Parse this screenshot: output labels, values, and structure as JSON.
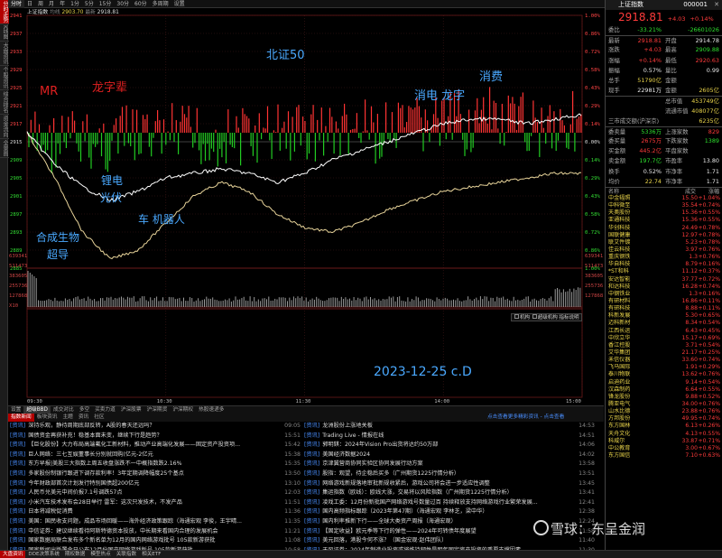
{
  "left_tabs": [
    "分时走势",
    "K线图",
    "大盘资讯",
    "个股资讯",
    "综合排名",
    "资金流向",
    "全景图"
  ],
  "top_bar": {
    "items": [
      "分时",
      "日",
      "周",
      "月",
      "年",
      "1分",
      "5分",
      "15分",
      "30分",
      "60分",
      "多周期",
      "设置"
    ],
    "active": "分时",
    "right_items": [
      "九转",
      "数据看盘",
      "大盘异动",
      "模式"
    ]
  },
  "chart_info": {
    "name": "上证指数",
    "label": "均线",
    "val1": "2903.70",
    "label2": "最新",
    "val2": "2918.81"
  },
  "left_axis_price": [
    "2941",
    "2937",
    "2933",
    "2929",
    "2925",
    "2921",
    "2917",
    "2913",
    "2909",
    "2905",
    "2901",
    "2897",
    "2893",
    "2889",
    "2885"
  ],
  "left_axis_zero": "2915",
  "right_axis_pct": [
    "1.00%",
    "0.86%",
    "0.72%",
    "0.58%",
    "0.43%",
    "0.29%",
    "0.14%",
    "0.00%",
    "0.14%",
    "0.29%",
    "0.43%",
    "0.58%",
    "0.72%",
    "0.86%",
    "1.00%"
  ],
  "right_axis_pct2": [
    "0.00%",
    "0.09%",
    "0.18%",
    "0.27%",
    "0.36%",
    "0.45%",
    "0.54%",
    "0.63%",
    "0.72%",
    "0.81%",
    "0.90%",
    "0.99%",
    "1.08%"
  ],
  "volume_axis": [
    "639341",
    "511473",
    "383605",
    "255736",
    "127868",
    "X10"
  ],
  "time_labels": [
    "09:30",
    "10:30",
    "11:30",
    "14:00",
    "15:00"
  ],
  "annotations": {
    "mr": "MR",
    "longzi": "龙字辈",
    "beizheng": "北证50",
    "xiaofei": "消费",
    "xiaodian": "消电 龙字",
    "lidian": "锂电",
    "guangfu": "光伏",
    "car": "车 机器人",
    "hecheng": "合成生物",
    "chaodao": "超导",
    "date": "2023-12-25 c.D"
  },
  "legend": {
    "a": "机构",
    "b": "超级机构",
    "c": "指标说明"
  },
  "bottom_tabs": [
    "设置",
    "超级BBD",
    "成交对比",
    "多空",
    "买卖力道",
    "沪深股票",
    "沪深期货",
    "沪深期权",
    "热股速递多"
  ],
  "bottom_active": "超级BBD",
  "news_tabs": [
    "指数新闻",
    "板块资讯",
    "主题",
    "资讯",
    "社区"
  ],
  "news_active": "指数新闻",
  "news_right": "点击查看更多精彩资讯 - 点击查看",
  "news_left": [
    {
      "tag": "[资讯]",
      "title": "深持乐观，静待周期底部反转，A股的春天还远吗？",
      "time": "09:05"
    },
    {
      "tag": "[资讯]",
      "title": "国债资金再获补充！稳基本面未变，继续下行是趋势？",
      "time": "15:51"
    },
    {
      "tag": "[资讯]",
      "title": "【巨化股份】大力布局高端氟化工新材料，推动产业高端化发展——固定资产投资项...",
      "time": "15:42"
    },
    {
      "tag": "[资讯]",
      "title": "巨人网络：三七互娱董事长分别就回购(亿元-2亿元",
      "time": "15:38"
    },
    {
      "tag": "[资讯]",
      "title": "东方早报|美股三大指数上周五收盘涨跌不一中概指数跌2.16%",
      "time": "15:35"
    },
    {
      "tag": "[资讯]",
      "title": "多家股份制银行跟进下调存款利率！3年定期调降幅度25个基点",
      "time": "13:50"
    },
    {
      "tag": "[资讯]",
      "title": "今年财政部首次计划发行特别国债超200亿元",
      "time": "13:10"
    },
    {
      "tag": "[资讯]",
      "title": "人民币兑美元中间价报7.1号调跌57点",
      "time": "12:03"
    },
    {
      "tag": "[资讯]",
      "title": "小米汽车技术发布会28日举行 雷军：这次只发技术，不发产品",
      "time": "11:51"
    },
    {
      "tag": "[资讯]",
      "title": "日本将减税促消费",
      "time": "11:36"
    },
    {
      "tag": "[资讯]",
      "title": "美国：国民收支问题，成品市场回暖——海外经济政策跟踪（海通宏观 李俊，王宇晴...",
      "time": "11:35"
    },
    {
      "tag": "[资讯]",
      "title": "中信证券：建议继续看待阿斯特德资本投放，中长期来看国内合理的发展机会",
      "time": "11:21"
    },
    {
      "tag": "[资讯]",
      "title": "国家数据局联合发布多个新名单为12月的国内网络游戏批号 105款新游获批",
      "time": "11:08"
    },
    {
      "tag": "[资讯]",
      "title": "国家新闻出版署今日公布12月份国产网络游戏版号 105款新游获批",
      "time": "10:58"
    },
    {
      "tag": "[资讯]",
      "title": "大宗资产周度跟踪（2023/12/18-2023/12/22）（国金宏观·赵伟团队）",
      "time": "10:48"
    }
  ],
  "news_right_list": [
    {
      "tag": "[资讯]",
      "title": "龙洲股份上涨地关板",
      "time": "14:53"
    },
    {
      "tag": "[资讯]",
      "title": "Trading Live - 情报在线",
      "time": "14:51"
    },
    {
      "tag": "[资讯]",
      "title": "郭明錤：2024年Vision Pro出货将达约50万部",
      "time": "14:06"
    },
    {
      "tag": "[资讯]",
      "title": "美国经济数据2024",
      "time": "14:02"
    },
    {
      "tag": "[资讯]",
      "title": "京津冀营商协同实验区协同发展行动方案",
      "time": "13:58"
    },
    {
      "tag": "[资讯]",
      "title": "股指：观望，待企稳后买多（广州期货1225行情分析）",
      "time": "13:51"
    },
    {
      "tag": "[资讯]",
      "title": "网络游戏新规落地审批新规收紧后，游戏公司将会进一步适应性调整",
      "time": "13:45"
    },
    {
      "tag": "[资讯]",
      "title": "集运指数（欧线）：欧线大涨，交易将以风险指数（广州期货1225行情分析）",
      "time": "13:41"
    },
    {
      "tag": "[资讯]",
      "title": "凌戏工委：12月份新批国产网络游戏号数量过百 持续释放支持网络游戏行业繁荣发展...",
      "time": "12:41"
    },
    {
      "tag": "[资讯]",
      "title": "国内高频指标跟踪（2023年第47期）（海通宏观 李林芝，梁中华）",
      "time": "12:38"
    },
    {
      "tag": "[资讯]",
      "title": "国内利率推新下行——全球大类资产周报（海通宏观）",
      "time": "12:24"
    },
    {
      "tag": "[资讯]",
      "title": "【固定收益】欧元季等下行的弹性——2024年可转债年度展望",
      "time": "11:58"
    },
    {
      "tag": "[资讯]",
      "title": "美元回落，港股今何不涨？（国金宏观·赵伟团队）",
      "time": "11:40"
    },
    {
      "tag": "[资讯]",
      "title": "天风证券：2024年制造业投资或将维持韧性是明年固定资产投资的重要支撑因素",
      "time": "11:30"
    },
    {
      "tag": "[资讯]",
      "title": "大宗资产周度跟踪（国金宏观·赵伟团队）",
      "time": "11:22"
    }
  ],
  "status_bar": [
    "大盘资讯",
    "DDE决策系统",
    "期权数据",
    "模型热点",
    "关联指数",
    "相关ETF"
  ],
  "status_active": "大盘资讯",
  "quote": {
    "title": "上证指数",
    "code": "000001",
    "price": "2918.81",
    "chg": "+4.03",
    "pct": "+0.14%",
    "rows": [
      {
        "l": "委比",
        "v": "-33.21%",
        "vc": "grn",
        "l2": "",
        "v2": "-26601026",
        "v2c": "grn"
      },
      {
        "l": "最新",
        "v": "2918.81",
        "vc": "red",
        "l2": "开盘",
        "v2": "2914.78",
        "v2c": "wht"
      },
      {
        "l": "涨跌",
        "v": "+4.03",
        "vc": "red",
        "l2": "最高",
        "v2": "2909.88",
        "v2c": "grn"
      },
      {
        "l": "涨幅",
        "v": "+0.14%",
        "vc": "red",
        "l2": "最低",
        "v2": "2920.63",
        "v2c": "red"
      },
      {
        "l": "振幅",
        "v": "0.57%",
        "vc": "wht",
        "l2": "量比",
        "v2": "0.99",
        "v2c": "wht"
      },
      {
        "l": "总手",
        "v": "51790亿",
        "vc": "yel",
        "l2": "金额",
        "v2": "",
        "v2c": "wht"
      },
      {
        "l": "现手",
        "v": "22981万",
        "vc": "wht",
        "l2": "金额",
        "v2": "2605亿",
        "v2c": "yel"
      },
      {
        "l": "",
        "v": "",
        "vc": "wht",
        "l2": "总市值",
        "v2": "453749亿",
        "v2c": "yel"
      },
      {
        "l": "",
        "v": "",
        "vc": "wht",
        "l2": "流通市值",
        "v2": "408077亿",
        "v2c": "yel"
      },
      {
        "l": "三市成交额(沪深京)",
        "v": "",
        "vc": "wht",
        "l2": "",
        "v2": "6235亿",
        "v2c": "yel"
      },
      {
        "l": "委卖量",
        "v": "5336万",
        "vc": "grn",
        "l2": "上涨家数",
        "v2": "829",
        "v2c": "red"
      },
      {
        "l": "委买量",
        "v": "2675万",
        "vc": "red",
        "l2": "下跌家数",
        "v2": "1389",
        "v2c": "grn"
      },
      {
        "l": "买金额",
        "v": "445.2亿",
        "vc": "red",
        "l2": "平盘家数",
        "v2": "",
        "v2c": "wht"
      },
      {
        "l": "卖金额",
        "v": "197.7亿",
        "vc": "grn",
        "l2": "市盈率",
        "v2": "13.80",
        "v2c": "wht"
      },
      {
        "l": "换手",
        "v": "0.52%",
        "vc": "wht",
        "l2": "市净率",
        "v2": "1.71",
        "v2c": "wht"
      },
      {
        "l": "均价",
        "v": "22.74",
        "vc": "yel",
        "l2": "市净率",
        "v2": "1.71",
        "v2c": "wht"
      }
    ]
  },
  "stock_header": {
    "name": "名称",
    "price": "成交",
    "chg": "涨幅"
  },
  "stocks": [
    {
      "n": "中金辐照",
      "p": "15.50",
      "c": "+1.04%",
      "dir": "red"
    },
    {
      "n": "中科微至",
      "p": "35.54",
      "c": "+0.74%",
      "dir": "red"
    },
    {
      "n": "天奥股份",
      "p": "15.36",
      "c": "+0.55%",
      "dir": "red"
    },
    {
      "n": "亚通科技",
      "p": "15.36",
      "c": "+0.55%",
      "dir": "red"
    },
    {
      "n": "华创科技",
      "p": "24.49",
      "c": "+0.78%",
      "dir": "red"
    },
    {
      "n": "国联健康",
      "p": "12.97",
      "c": "+0.78%",
      "dir": "red"
    },
    {
      "n": "联艾件镀",
      "p": "5.23",
      "c": "+0.78%",
      "dir": "red"
    },
    {
      "n": "佳云科技",
      "p": "3.97",
      "c": "+0.76%",
      "dir": "red"
    },
    {
      "n": "重庆钢铁",
      "p": "1.3",
      "c": "+0.76%",
      "dir": "red"
    },
    {
      "n": "华自科技",
      "p": "8.79",
      "c": "+0.16%",
      "dir": "red"
    },
    {
      "n": "*ST和科",
      "p": "11.12",
      "c": "+0.37%",
      "dir": "red"
    },
    {
      "n": "安达智能",
      "p": "37.77",
      "c": "+0.72%",
      "dir": "red"
    },
    {
      "n": "和达科技",
      "p": "16.28",
      "c": "+0.74%",
      "dir": "red"
    },
    {
      "n": "中钢铁业",
      "p": "1.3",
      "c": "+0.16%",
      "dir": "red"
    },
    {
      "n": "有研材料",
      "p": "16.86",
      "c": "+0.11%",
      "dir": "red"
    },
    {
      "n": "有研科技",
      "p": "8.88",
      "c": "+0.11%",
      "dir": "red"
    },
    {
      "n": "科新发展",
      "p": "5.30",
      "c": "+0.65%",
      "dir": "red"
    },
    {
      "n": "迈科新材",
      "p": "8.34",
      "c": "+0.54%",
      "dir": "red"
    },
    {
      "n": "江西长运",
      "p": "6.43",
      "c": "+0.45%",
      "dir": "red"
    },
    {
      "n": "中欣立华",
      "p": "15.17",
      "c": "+0.69%",
      "dir": "red"
    },
    {
      "n": "香江控股",
      "p": "3.71",
      "c": "+0.54%",
      "dir": "red"
    },
    {
      "n": "艾华集团",
      "p": "21.17",
      "c": "+0.25%",
      "dir": "red"
    },
    {
      "n": "禾信仪器",
      "p": "33.60",
      "c": "+0.74%",
      "dir": "red"
    },
    {
      "n": "飞马国际",
      "p": "1.91",
      "c": "+0.29%",
      "dir": "red"
    },
    {
      "n": "泰川物联",
      "p": "13.62",
      "c": "+0.76%",
      "dir": "red"
    },
    {
      "n": "启迪药业",
      "p": "9.14",
      "c": "+0.54%",
      "dir": "red"
    },
    {
      "n": "汉森制药",
      "p": "6.64",
      "c": "+0.55%",
      "dir": "red"
    },
    {
      "n": "锋龙股份",
      "p": "9.88",
      "c": "+0.52%",
      "dir": "red"
    },
    {
      "n": "腾亚电气",
      "p": "34.00",
      "c": "+0.76%",
      "dir": "red"
    },
    {
      "n": "山水比德",
      "p": "23.88",
      "c": "+0.76%",
      "dir": "red"
    },
    {
      "n": "方邦股份",
      "p": "49.95",
      "c": "+0.74%",
      "dir": "red"
    },
    {
      "n": "东方国林",
      "p": "6.13",
      "c": "+0.26%",
      "dir": "red"
    },
    {
      "n": "天舟文化",
      "p": "4.13",
      "c": "+0.55%",
      "dir": "red"
    },
    {
      "n": "科威尔",
      "p": "33.87",
      "c": "+0.71%",
      "dir": "red"
    },
    {
      "n": "中公教育",
      "p": "3.00",
      "c": "+0.67%",
      "dir": "red"
    },
    {
      "n": "东方国信",
      "p": "7.10",
      "c": "+0.63%",
      "dir": "red"
    }
  ],
  "watermark": "雪球：东呈金润",
  "chart_data": {
    "type": "line",
    "title": "",
    "x": [
      "09:30",
      "10:30",
      "11:30",
      "14:00",
      "15:00"
    ],
    "ylim": [
      2885,
      2941
    ],
    "series": [
      {
        "name": "",
        "values": [
          2915,
          2908,
          2903,
          2900,
          2902,
          2905,
          2906,
          2907,
          2906,
          2904,
          2906,
          2909,
          2911,
          2913,
          2915,
          2917,
          2918,
          2918,
          2917,
          2918,
          2919
        ]
      },
      {
        "name": "",
        "values": [
          2915,
          2905,
          2893,
          2887,
          2889,
          2895,
          2901,
          2904,
          2902,
          2897,
          2894,
          2893,
          2895,
          2898,
          2900,
          2902,
          2903,
          2904,
          2905,
          2906,
          2906
        ]
      }
    ],
    "colors": {
      "index": "#ffffff",
      "avg": "#e8d49a",
      "up": "#ff3333",
      "down": "#22cc22",
      "volume": "#9a9a9a"
    }
  }
}
